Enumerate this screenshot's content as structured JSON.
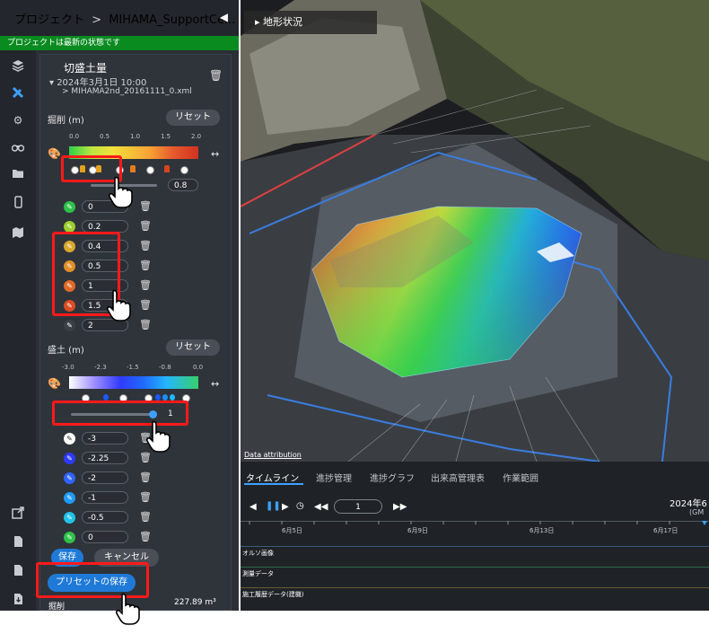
{
  "header": {
    "project_label": "プロジェクト",
    "breadcrumb_sep": ">",
    "project_name": "MIHAMA_SupportCe...",
    "caret": "▾",
    "collapse": "◀"
  },
  "status": {
    "text": "プロジェクトは最新の状態です"
  },
  "panel": {
    "title": "切盛土量",
    "date": "▾ 2024年3月1日 10:00",
    "file": "> MIHAMA2nd_20161111_0.xml",
    "cut": {
      "label": "掘削 (m)",
      "reset": "リセット",
      "ticks": [
        "0.0",
        "0.5",
        "1.0",
        "1.5",
        "2.0"
      ],
      "slider_value": "0.8",
      "rows": [
        {
          "value": "0",
          "color": "#2fc14a"
        },
        {
          "value": "0.2",
          "color": "#9ccd2d"
        },
        {
          "value": "0.4",
          "color": "#d8a72c"
        },
        {
          "value": "0.5",
          "color": "#df8f28"
        },
        {
          "value": "1",
          "color": "#e06a28"
        },
        {
          "value": "1.5",
          "color": "#dd4b22"
        },
        {
          "value": "2",
          "color": "#3a3f45"
        }
      ]
    },
    "fill": {
      "label": "盛土 (m)",
      "reset": "リセット",
      "ticks": [
        "-3.0",
        "-2.3",
        "-1.5",
        "-0.8",
        "0.0"
      ],
      "slider_value": "1",
      "rows": [
        {
          "value": "-3",
          "color": "#ffffff"
        },
        {
          "value": "-2.25",
          "color": "#2d3bff"
        },
        {
          "value": "-2",
          "color": "#2f64ff"
        },
        {
          "value": "-1",
          "color": "#1f9bff"
        },
        {
          "value": "-0.5",
          "color": "#22c2e8"
        },
        {
          "value": "0",
          "color": "#2fc14a"
        }
      ]
    },
    "save": "保存",
    "cancel": "キャンセル",
    "preset_save": "プリセットの保存",
    "cut_volume_label": "掘削",
    "cut_volume_value": "227.89 m³"
  },
  "map": {
    "label_prefix": "▸",
    "label": "地形状況",
    "attribution": "Data attribution"
  },
  "timeline": {
    "tabs": [
      "タイムライン",
      "進捗管理",
      "進捗グラフ",
      "出来高管理表",
      "作業範囲"
    ],
    "page_value": "1",
    "date_right": "2024年6",
    "tz": "(GM",
    "dates": [
      "6月5日",
      "6月9日",
      "6月13日",
      "6月17日"
    ],
    "tracks": [
      "オルソ画像",
      "測量データ",
      "施工履歴データ(建機)"
    ]
  },
  "colors": {
    "accent": "#3da0ff",
    "status_green": "#0a8b20",
    "highlight_red": "#ff1a1a"
  }
}
